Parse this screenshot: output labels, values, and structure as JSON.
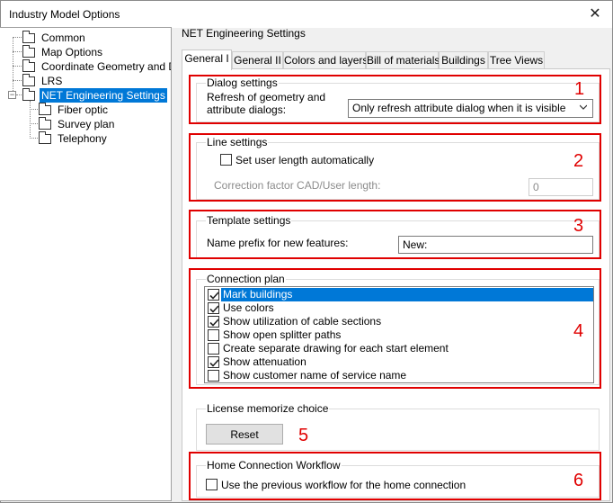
{
  "window": {
    "title": "Industry Model Options"
  },
  "tree": {
    "items": [
      {
        "label": "Common"
      },
      {
        "label": "Map Options"
      },
      {
        "label": "Coordinate Geometry and Dime"
      },
      {
        "label": "LRS"
      },
      {
        "label": "NET Engineering Settings",
        "selected": true,
        "expander": "−"
      },
      {
        "label": "Fiber optic"
      },
      {
        "label": "Survey plan"
      },
      {
        "label": "Telephony"
      }
    ]
  },
  "panel": {
    "title": "NET Engineering Settings"
  },
  "tabs": [
    {
      "label": "General I",
      "active": true
    },
    {
      "label": "General II"
    },
    {
      "label": "Colors and layers"
    },
    {
      "label": "Bill of materials"
    },
    {
      "label": "Buildings"
    },
    {
      "label": "Tree Views"
    }
  ],
  "dialog_settings": {
    "title": "Dialog settings",
    "refresh_label_line1": "Refresh of geometry and",
    "refresh_label_line2": "attribute dialogs:",
    "refresh_value": "Only refresh attribute dialog when it is visible"
  },
  "line_settings": {
    "title": "Line settings",
    "set_user_length_label": "Set user length automatically",
    "set_user_length_checked": false,
    "correction_label": "Correction factor CAD/User length:",
    "correction_value": "0"
  },
  "template_settings": {
    "title": "Template settings",
    "name_prefix_label": "Name prefix for new features:",
    "name_prefix_value": "New:"
  },
  "connection_plan": {
    "title": "Connection plan",
    "items": [
      {
        "label": "Mark buildings",
        "checked": true,
        "selected": true
      },
      {
        "label": "Use colors",
        "checked": true
      },
      {
        "label": "Show utilization of cable sections",
        "checked": true
      },
      {
        "label": "Show open splitter paths",
        "checked": false
      },
      {
        "label": "Create separate drawing for each start element",
        "checked": false
      },
      {
        "label": "Show attenuation",
        "checked": true
      },
      {
        "label": "Show customer name of service name",
        "checked": false
      }
    ]
  },
  "license": {
    "title": "License memorize choice",
    "reset_label": "Reset"
  },
  "home_connection": {
    "title": "Home Connection Workflow",
    "use_previous_label": "Use the previous workflow for the home connection",
    "use_previous_checked": false
  },
  "annotations": [
    "1",
    "2",
    "3",
    "4",
    "5",
    "6"
  ],
  "colors": {
    "highlight_blue": "#0078d7",
    "annotation_red": "#e00000"
  }
}
